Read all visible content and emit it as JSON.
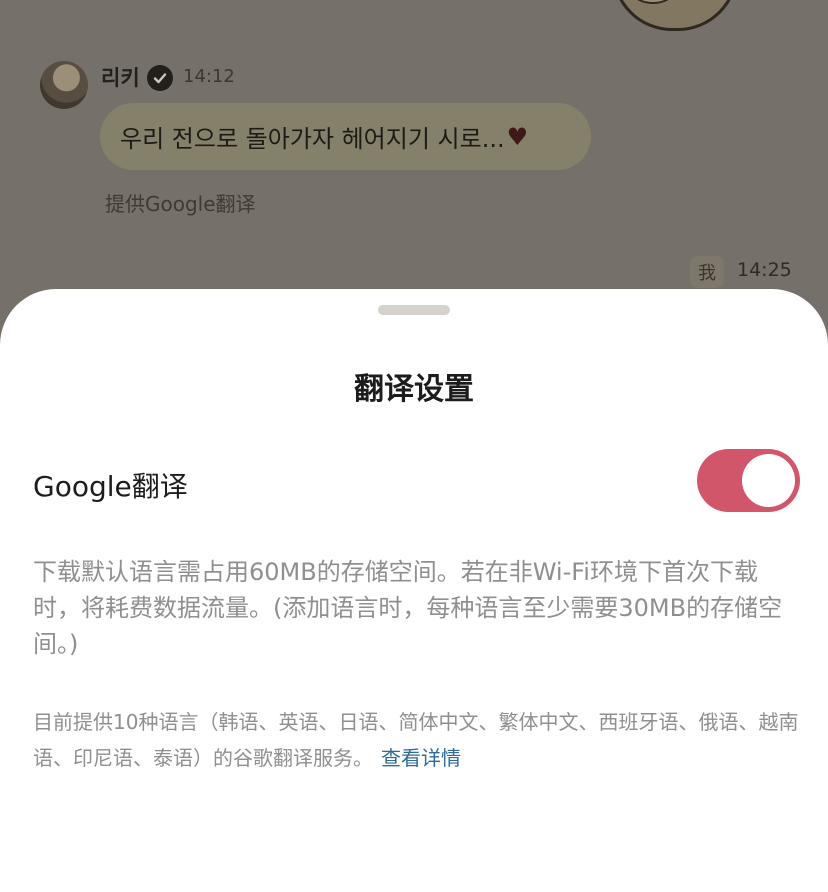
{
  "chat": {
    "sender_name": "리키",
    "message_time": "14:12",
    "message_text": "우리 전으로 돌아가자 헤어지기 시로...",
    "message_emoji": "♥",
    "translated_by": "提供Google翻译",
    "me_badge": "我",
    "me_time": "14:25"
  },
  "sheet": {
    "title": "翻译设置",
    "google_translate_label": "Google翻译",
    "google_translate_enabled": true,
    "toggle_color": "#d1566a",
    "description": "下载默认语言需占用60MB的存储空间。若在非Wi-Fi环境下首次下载时，将耗费数据流量。(添加语言时，每种语言至少需要30MB的存储空间。)",
    "note": "目前提供10种语言（韩语、英语、日语、简体中文、繁体中文、西班牙语、俄语、越南语、印尼语、泰语）的谷歌翻译服务。",
    "details_link": "查看详情"
  }
}
